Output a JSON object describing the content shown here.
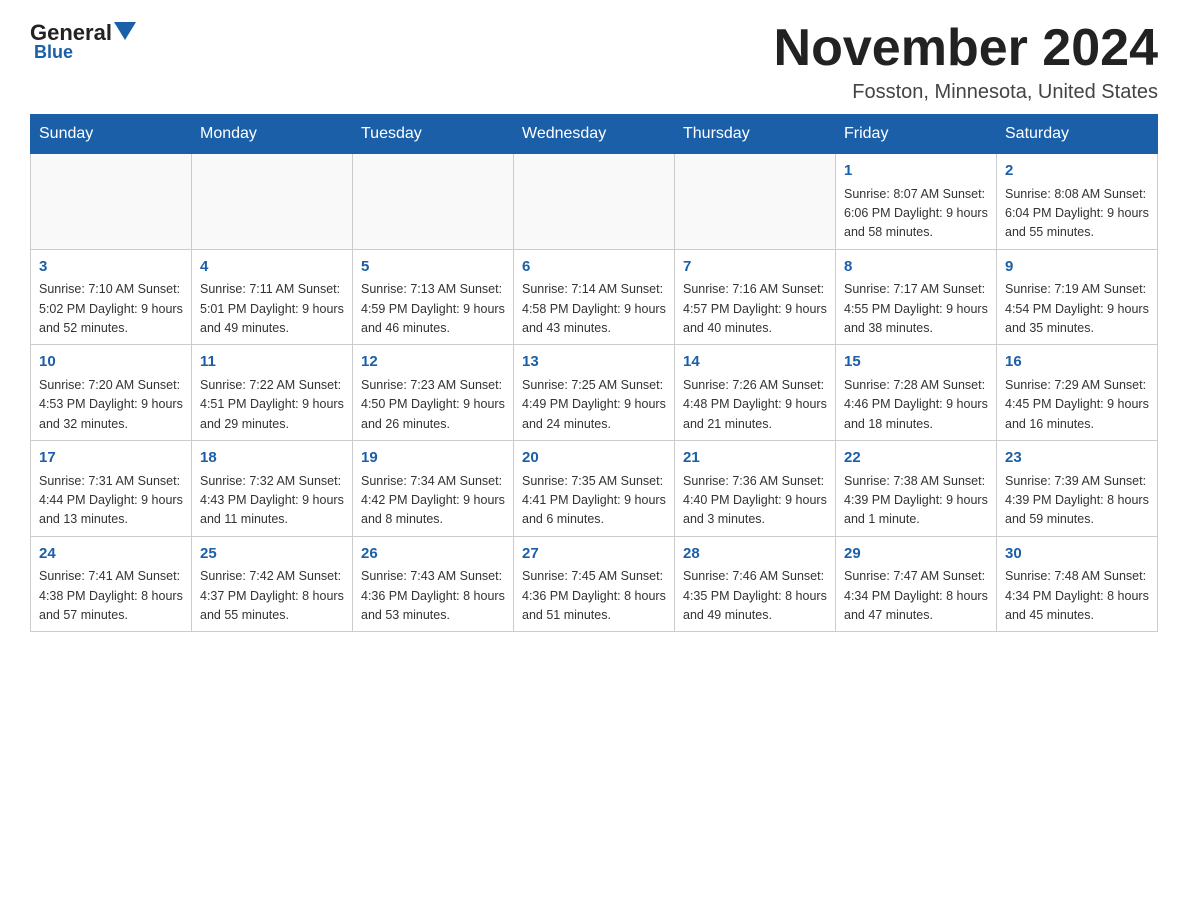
{
  "logo": {
    "name1": "General",
    "name2": "Blue"
  },
  "title": "November 2024",
  "location": "Fosston, Minnesota, United States",
  "days_of_week": [
    "Sunday",
    "Monday",
    "Tuesday",
    "Wednesday",
    "Thursday",
    "Friday",
    "Saturday"
  ],
  "weeks": [
    [
      {
        "day": "",
        "info": ""
      },
      {
        "day": "",
        "info": ""
      },
      {
        "day": "",
        "info": ""
      },
      {
        "day": "",
        "info": ""
      },
      {
        "day": "",
        "info": ""
      },
      {
        "day": "1",
        "info": "Sunrise: 8:07 AM\nSunset: 6:06 PM\nDaylight: 9 hours and 58 minutes."
      },
      {
        "day": "2",
        "info": "Sunrise: 8:08 AM\nSunset: 6:04 PM\nDaylight: 9 hours and 55 minutes."
      }
    ],
    [
      {
        "day": "3",
        "info": "Sunrise: 7:10 AM\nSunset: 5:02 PM\nDaylight: 9 hours and 52 minutes."
      },
      {
        "day": "4",
        "info": "Sunrise: 7:11 AM\nSunset: 5:01 PM\nDaylight: 9 hours and 49 minutes."
      },
      {
        "day": "5",
        "info": "Sunrise: 7:13 AM\nSunset: 4:59 PM\nDaylight: 9 hours and 46 minutes."
      },
      {
        "day": "6",
        "info": "Sunrise: 7:14 AM\nSunset: 4:58 PM\nDaylight: 9 hours and 43 minutes."
      },
      {
        "day": "7",
        "info": "Sunrise: 7:16 AM\nSunset: 4:57 PM\nDaylight: 9 hours and 40 minutes."
      },
      {
        "day": "8",
        "info": "Sunrise: 7:17 AM\nSunset: 4:55 PM\nDaylight: 9 hours and 38 minutes."
      },
      {
        "day": "9",
        "info": "Sunrise: 7:19 AM\nSunset: 4:54 PM\nDaylight: 9 hours and 35 minutes."
      }
    ],
    [
      {
        "day": "10",
        "info": "Sunrise: 7:20 AM\nSunset: 4:53 PM\nDaylight: 9 hours and 32 minutes."
      },
      {
        "day": "11",
        "info": "Sunrise: 7:22 AM\nSunset: 4:51 PM\nDaylight: 9 hours and 29 minutes."
      },
      {
        "day": "12",
        "info": "Sunrise: 7:23 AM\nSunset: 4:50 PM\nDaylight: 9 hours and 26 minutes."
      },
      {
        "day": "13",
        "info": "Sunrise: 7:25 AM\nSunset: 4:49 PM\nDaylight: 9 hours and 24 minutes."
      },
      {
        "day": "14",
        "info": "Sunrise: 7:26 AM\nSunset: 4:48 PM\nDaylight: 9 hours and 21 minutes."
      },
      {
        "day": "15",
        "info": "Sunrise: 7:28 AM\nSunset: 4:46 PM\nDaylight: 9 hours and 18 minutes."
      },
      {
        "day": "16",
        "info": "Sunrise: 7:29 AM\nSunset: 4:45 PM\nDaylight: 9 hours and 16 minutes."
      }
    ],
    [
      {
        "day": "17",
        "info": "Sunrise: 7:31 AM\nSunset: 4:44 PM\nDaylight: 9 hours and 13 minutes."
      },
      {
        "day": "18",
        "info": "Sunrise: 7:32 AM\nSunset: 4:43 PM\nDaylight: 9 hours and 11 minutes."
      },
      {
        "day": "19",
        "info": "Sunrise: 7:34 AM\nSunset: 4:42 PM\nDaylight: 9 hours and 8 minutes."
      },
      {
        "day": "20",
        "info": "Sunrise: 7:35 AM\nSunset: 4:41 PM\nDaylight: 9 hours and 6 minutes."
      },
      {
        "day": "21",
        "info": "Sunrise: 7:36 AM\nSunset: 4:40 PM\nDaylight: 9 hours and 3 minutes."
      },
      {
        "day": "22",
        "info": "Sunrise: 7:38 AM\nSunset: 4:39 PM\nDaylight: 9 hours and 1 minute."
      },
      {
        "day": "23",
        "info": "Sunrise: 7:39 AM\nSunset: 4:39 PM\nDaylight: 8 hours and 59 minutes."
      }
    ],
    [
      {
        "day": "24",
        "info": "Sunrise: 7:41 AM\nSunset: 4:38 PM\nDaylight: 8 hours and 57 minutes."
      },
      {
        "day": "25",
        "info": "Sunrise: 7:42 AM\nSunset: 4:37 PM\nDaylight: 8 hours and 55 minutes."
      },
      {
        "day": "26",
        "info": "Sunrise: 7:43 AM\nSunset: 4:36 PM\nDaylight: 8 hours and 53 minutes."
      },
      {
        "day": "27",
        "info": "Sunrise: 7:45 AM\nSunset: 4:36 PM\nDaylight: 8 hours and 51 minutes."
      },
      {
        "day": "28",
        "info": "Sunrise: 7:46 AM\nSunset: 4:35 PM\nDaylight: 8 hours and 49 minutes."
      },
      {
        "day": "29",
        "info": "Sunrise: 7:47 AM\nSunset: 4:34 PM\nDaylight: 8 hours and 47 minutes."
      },
      {
        "day": "30",
        "info": "Sunrise: 7:48 AM\nSunset: 4:34 PM\nDaylight: 8 hours and 45 minutes."
      }
    ]
  ]
}
